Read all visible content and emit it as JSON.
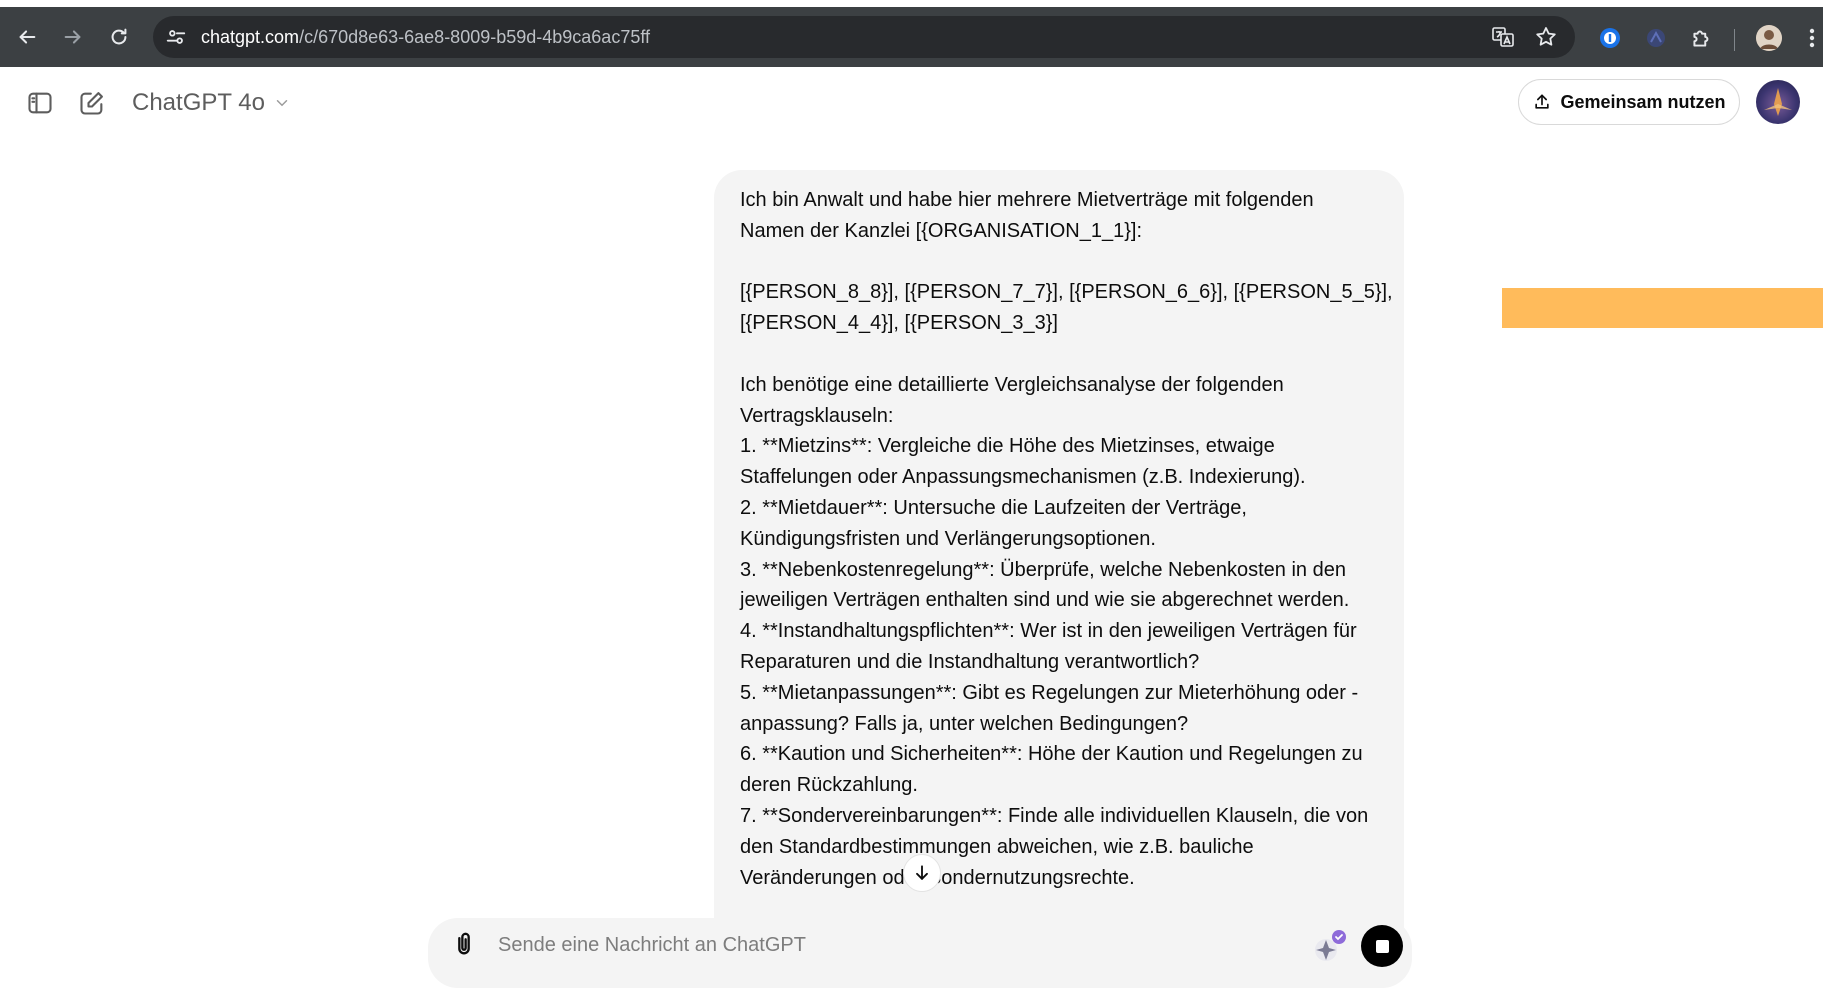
{
  "browser": {
    "url_host": "chatgpt.com",
    "url_path": "/c/670d8e63-6ae8-8009-b59d-4b9ca6ac75ff",
    "icons": [
      "back-arrow-icon",
      "forward-arrow-icon",
      "reload-icon",
      "site-settings-icon",
      "translate-icon",
      "bookmark-star-icon",
      "password-manager-icon",
      "extension-icon",
      "puzzle-extensions-icon",
      "profile-avatar-icon",
      "more-menu-icon"
    ]
  },
  "header": {
    "model_name": "ChatGPT 4o",
    "share_label": "Gemeinsam nutzen",
    "icons": [
      "sidebar-toggle-icon",
      "new-chat-icon",
      "chevron-down-icon",
      "share-upload-icon"
    ]
  },
  "message": {
    "lines": [
      "Ich bin Anwalt und habe hier mehrere Mietverträge mit folgenden",
      "Namen der Kanzlei [{ORGANISATION_1_1}]:",
      "",
      "[{PERSON_8_8}], [{PERSON_7_7}], [{PERSON_6_6}], [{PERSON_5_5}],",
      "[{PERSON_4_4}], [{PERSON_3_3}]",
      "",
      "Ich benötige eine detaillierte Vergleichsanalyse der folgenden",
      "Vertragsklauseln:",
      "1. **Mietzins**: Vergleiche die Höhe des Mietzinses, etwaige",
      "Staffelungen oder Anpassungsmechanismen (z.B. Indexierung).",
      "2. **Mietdauer**: Untersuche die Laufzeiten der Verträge,",
      "Kündigungsfristen und Verlängerungsoptionen.",
      "3. **Nebenkostenregelung**: Überprüfe, welche Nebenkosten in den",
      "jeweiligen Verträgen enthalten sind und wie sie abgerechnet werden.",
      "4. **Instandhaltungspflichten**: Wer ist in den jeweiligen Verträgen für",
      "Reparaturen und die Instandhaltung verantwortlich?",
      "5. **Mietanpassungen**: Gibt es Regelungen zur Mieterhöhung oder -",
      "anpassung? Falls ja, unter welchen Bedingungen?",
      "6. **Kaution und Sicherheiten**: Höhe der Kaution und Regelungen zu",
      "deren Rückzahlung.",
      "7. **Sondervereinbarungen**: Finde alle individuellen Klauseln, die von",
      "den Standardbestimmungen abweichen, wie z.B. bauliche",
      "Veränderungen oder Sondernutzungsrechte."
    ]
  },
  "composer": {
    "placeholder": "Sende eine Nachricht an ChatGPT",
    "icons": [
      "paperclip-icon",
      "tool-extension-icon",
      "stop-icon",
      "scroll-down-arrow-icon"
    ]
  },
  "colors": {
    "browser_bar": "#3c4043",
    "url_box": "#282a2d",
    "bubble": "#f4f4f4",
    "orange_overlay": "#ffbb5b",
    "stop_button": "#000000"
  }
}
